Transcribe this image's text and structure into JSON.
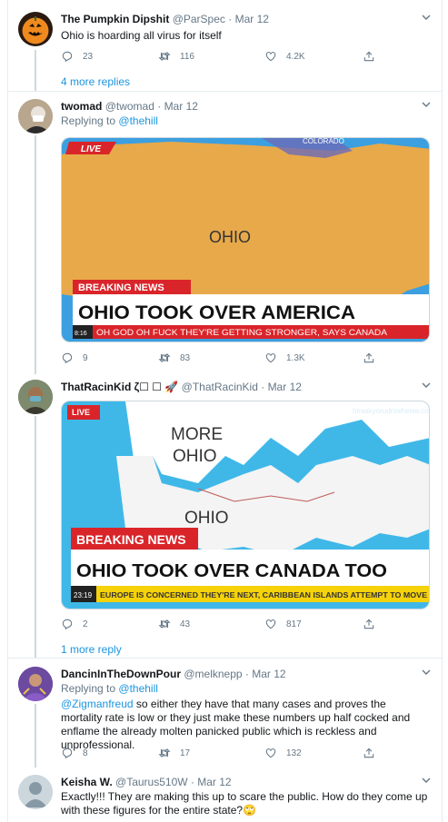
{
  "tweets": [
    {
      "name": "The Pumpkin Dipshit",
      "handle": "@ParSpec",
      "date": "· Mar 12",
      "text": "Ohio is hoarding all virus for itself",
      "reply_count": "23",
      "retweet_count": "116",
      "like_count": "4.2K",
      "more_replies": "4 more replies"
    },
    {
      "name": "twomad",
      "handle": "@twomad",
      "date": "· Mar 12",
      "replying_prefix": "Replying to",
      "replying_to": "@thehill",
      "media": {
        "live": "LIVE",
        "corner": "COLORADO",
        "map_label": "OHIO",
        "banner": "BREAKING NEWS",
        "headline": "OHIO TOOK OVER AMERICA",
        "time": "8:16",
        "ticker": "OH GOD OH FUCK THEY'RE GETTING STRONGER, SAYS CANADA"
      },
      "reply_count": "9",
      "retweet_count": "83",
      "like_count": "1.3K"
    },
    {
      "name": "ThatRacinKid ζ☐ ☐ 🚀",
      "handle": "@ThatRacinKid",
      "date": "· Mar 12",
      "media": {
        "live": "LIVE",
        "watermark": "hiraakyorudniwhewa.com",
        "label_top_1": "MORE",
        "label_top_2": "OHIO",
        "map_label": "OHIO",
        "banner": "BREAKING NEWS",
        "headline": "OHIO TOOK OVER CANADA TOO",
        "time": "23:19",
        "ticker": "EUROPE IS CONCERNED THEY'RE NEXT, CARIBBEAN ISLANDS ATTEMPT TO MOVE"
      },
      "reply_count": "2",
      "retweet_count": "43",
      "like_count": "817",
      "more_replies": "1 more reply"
    },
    {
      "name": "DancinInTheDownPour",
      "handle": "@melknepp",
      "date": "· Mar 12",
      "replying_prefix": "Replying to",
      "replying_to": "@thehill",
      "mention": "@Zigmanfreud",
      "text": " so either they have that many cases and proves the mortality rate is low or they just make these numbers up half cocked and enflame the already molten panicked public which is reckless and unprofessional.",
      "reply_count": "8",
      "retweet_count": "17",
      "like_count": "132"
    },
    {
      "name": "Keisha W.",
      "handle": "@Taurus510W",
      "date": "· Mar 12",
      "text": "Exactly!!! They are making this up to scare the public. How do they come up with these figures for the entire state?🙄"
    }
  ],
  "colors": {
    "accent": "#1b95e0",
    "muted": "#657786",
    "divider": "#e6ecf0",
    "breaking_red": "#d9252a",
    "ticker_yellow": "#f5d20a",
    "ocean_blue": "#3fb8e8",
    "land_orange": "#e8a94a"
  },
  "icons": [
    "reply-icon",
    "retweet-icon",
    "like-icon",
    "share-icon",
    "chevron-down-icon"
  ]
}
